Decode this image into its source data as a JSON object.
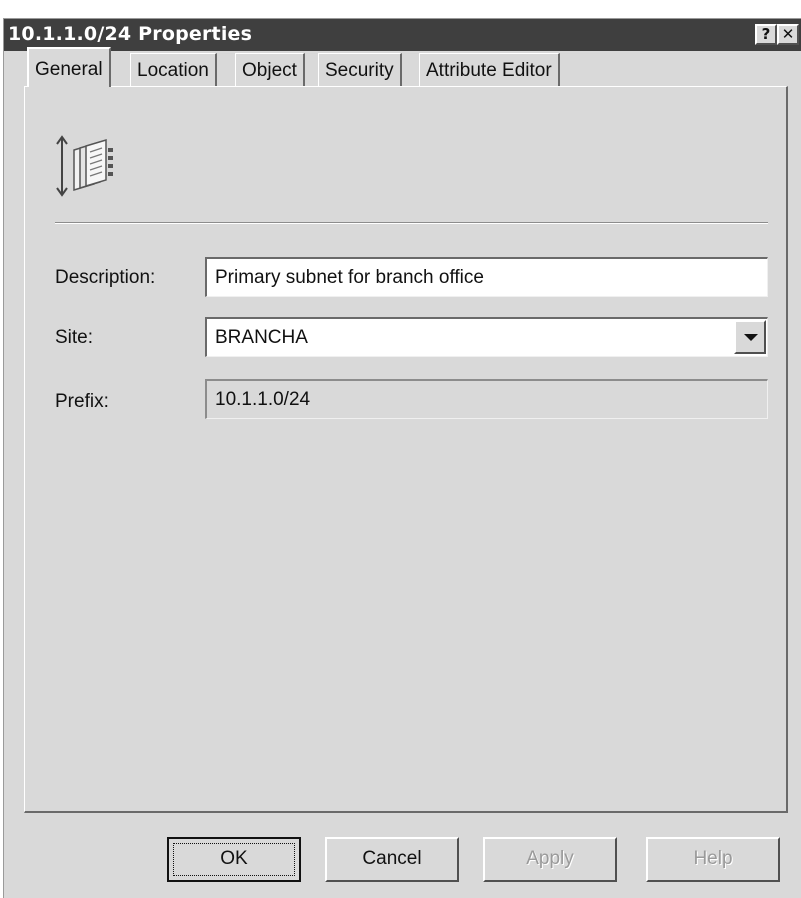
{
  "window": {
    "title": "10.1.1.0/24 Properties",
    "help_glyph": "?",
    "close_glyph": "✕"
  },
  "tabs": [
    {
      "label": "General",
      "active": true
    },
    {
      "label": "Location",
      "active": false
    },
    {
      "label": "Object",
      "active": false
    },
    {
      "label": "Security",
      "active": false
    },
    {
      "label": "Attribute Editor",
      "active": false
    }
  ],
  "general": {
    "icon": "subnet-icon",
    "description": {
      "label": "Description:",
      "value": "Primary subnet for branch office"
    },
    "site": {
      "label": "Site:",
      "value": "BRANCHA"
    },
    "prefix": {
      "label": "Prefix:",
      "value": "10.1.1.0/24"
    }
  },
  "buttons": {
    "ok": "OK",
    "cancel": "Cancel",
    "apply": "Apply",
    "help": "Help"
  },
  "colors": {
    "titlebar": "#3f3f3f",
    "dialog_face": "#d9d9d9"
  }
}
